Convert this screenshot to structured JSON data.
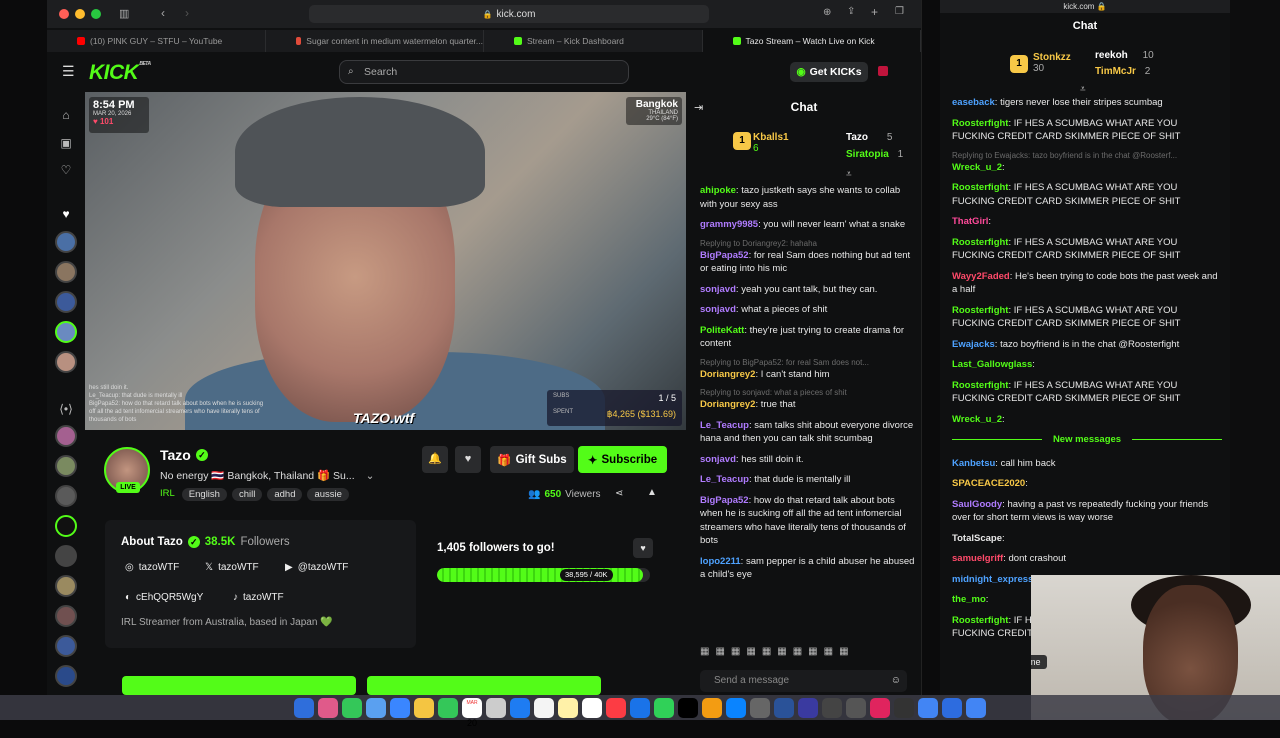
{
  "browser": {
    "url": "kick.com",
    "tabs": [
      {
        "label": "(10) PINK GUY – STFU – YouTube",
        "color": "#ff0000"
      },
      {
        "label": "Sugar content in medium watermelon quarter...",
        "color": "#e04b3a"
      },
      {
        "label": "Stream – Kick Dashboard",
        "color": "#53fc18"
      },
      {
        "label": "Tazo Stream – Watch Live on Kick",
        "color": "#53fc18"
      }
    ]
  },
  "header": {
    "logo": "KICK",
    "logo_sup": "BETA",
    "search_placeholder": "Search",
    "get_kicks": "Get KICKs"
  },
  "video": {
    "time": "8:54 PM",
    "date": "MAR 20, 2026",
    "heart_count": "101",
    "city": "Bangkok",
    "country": "THAILAND",
    "temp": "29°C (84°F)",
    "subs_label": "SUBS",
    "subs_frac": "1 / 5",
    "spent_label": "SPENT",
    "spent_amount": "฿4,265 ($131.69)",
    "watermark": "TAZO.wtf",
    "overlay_chat": [
      "hes still doin it.",
      "Le_Teacup: that dude is mentally ill",
      "BigPapa52: how do that retard talk about bots when he is sucking off all the ad tent infomercial streamers who have literally tens of thousands of bots"
    ]
  },
  "streamer": {
    "name": "Tazo",
    "live": "LIVE",
    "title": "No energy 🇹🇭 Bangkok, Thailand 🎁 Su...",
    "category": "IRL",
    "tags": [
      "English",
      "chill",
      "adhd",
      "aussie"
    ],
    "gift_subs": "Gift Subs",
    "subscribe": "Subscribe",
    "viewers_count": "650",
    "viewers_label": "Viewers"
  },
  "about": {
    "title": "About Tazo",
    "followers": "38.5K",
    "followers_label": "Followers",
    "instagram": "tazoWTF",
    "x": "tazoWTF",
    "youtube": "@tazoWTF",
    "discord": "cEhQQR5WgY",
    "tiktok": "tazoWTF",
    "bio": "IRL Streamer from Australia, based in Japan 💚"
  },
  "goal": {
    "title": "1,405 followers to go!",
    "count": "38,595 / 40K",
    "progress": 0.965
  },
  "chat1": {
    "title": "Chat",
    "leaders": [
      {
        "name": "Kballs1",
        "count": "6"
      },
      {
        "name": "Tazo",
        "count": "5"
      },
      {
        "name": "Siratopia",
        "count": "1"
      }
    ],
    "messages": [
      {
        "user": "ahipoke",
        "color": "#53fc18",
        "text": "tazo justketh says she wants to collab with your sexy ass"
      },
      {
        "user": "grammy9985",
        "color": "#b07cff",
        "text": "you will never learn' what a snake"
      },
      {
        "reply": "Replying to Doriangrey2: hahaha",
        "user": "BigPapa52",
        "color": "#b07cff",
        "text": "for real Sam does nothing but ad tent or eating into his mic"
      },
      {
        "user": "sonjavd",
        "color": "#b07cff",
        "text": "yeah you cant talk, but they can."
      },
      {
        "user": "sonjavd",
        "color": "#b07cff",
        "text": "what a pieces of shit"
      },
      {
        "user": "PoliteKatt",
        "color": "#53fc18",
        "text": "they're just trying to create drama for content"
      },
      {
        "reply": "Replying to BigPapa52: for real Sam does not...",
        "user": "Doriangrey2",
        "color": "#f7c847",
        "text": "I can't stand him"
      },
      {
        "reply": "Replying to sonjavd: what a pieces of shit",
        "user": "Doriangrey2",
        "color": "#f7c847",
        "text": "true that"
      },
      {
        "user": "Le_Teacup",
        "color": "#b07cff",
        "text": "sam talks shit about everyone divorce hana and then you can talk shit scumbag"
      },
      {
        "user": "sonjavd",
        "color": "#b07cff",
        "text": "hes still doin it."
      },
      {
        "user": "Le_Teacup",
        "color": "#b07cff",
        "text": "that dude is mentally ill"
      },
      {
        "user": "BigPapa52",
        "color": "#b07cff",
        "text": "how do that retard talk about bots when he is sucking off all the ad tent infomercial streamers who have literally tens of thousands of bots"
      },
      {
        "user": "lopo2211",
        "color": "#4ea2ff",
        "text": "sam pepper is a child abuser he abused a child's eye"
      }
    ],
    "input_placeholder": "Send a message"
  },
  "chat2": {
    "url": "kick.com",
    "title": "Chat",
    "leaders": [
      {
        "name": "Stonkzz",
        "count": "30"
      },
      {
        "name": "reekoh",
        "count": "10"
      },
      {
        "name": "TimMcJr",
        "count": "2"
      }
    ],
    "messages": [
      {
        "user": "easeback",
        "color": "#4ea2ff",
        "text": "tigers never lose their stripes scumbag"
      },
      {
        "user": "Roosterfight",
        "color": "#53fc18",
        "text": "IF HES A SCUMBAG WHAT ARE YOU FUCKING CREDIT CARD SKIMMER PIECE OF SHIT"
      },
      {
        "reply": "Replying to Ewajacks: tazo boyfriend is in the chat @Roosterf...",
        "user": "Wreck_u_2",
        "color": "#53fc18",
        "text": ""
      },
      {
        "user": "Roosterfight",
        "color": "#53fc18",
        "text": "IF HES A SCUMBAG WHAT ARE YOU FUCKING CREDIT CARD SKIMMER PIECE OF SHIT"
      },
      {
        "user": "ThatGirl",
        "color": "#ff4a9a",
        "text": ""
      },
      {
        "user": "Roosterfight",
        "color": "#53fc18",
        "text": "IF HES A SCUMBAG WHAT ARE YOU FUCKING CREDIT CARD SKIMMER PIECE OF SHIT"
      },
      {
        "user": "Wayy2Faded",
        "color": "#ff4a6a",
        "text": "He's been trying to code bots the past week and a half"
      },
      {
        "user": "Roosterfight",
        "color": "#53fc18",
        "text": "IF HES A SCUMBAG WHAT ARE YOU FUCKING CREDIT CARD SKIMMER PIECE OF SHIT"
      },
      {
        "user": "Ewajacks",
        "color": "#4ea2ff",
        "text": "tazo boyfriend is in the chat @Roosterfight"
      },
      {
        "user": "Last_Gallowglass",
        "color": "#53fc18",
        "text": ""
      },
      {
        "user": "Roosterfight",
        "color": "#53fc18",
        "text": "IF HES A SCUMBAG WHAT ARE YOU FUCKING CREDIT CARD SKIMMER PIECE OF SHIT"
      },
      {
        "user": "Wreck_u_2",
        "color": "#53fc18",
        "text": ""
      }
    ],
    "new_messages_label": "New messages",
    "new_messages": [
      {
        "user": "Kanbetsu",
        "color": "#4ea2ff",
        "text": "call him back"
      },
      {
        "user": "SPACEACE2020",
        "color": "#f7c847",
        "text": ""
      },
      {
        "user": "SaulGoody",
        "color": "#b07cff",
        "text": "having a past vs repeatedly fucking your friends over for short term views is way worse"
      },
      {
        "user": "TotalScape",
        "color": "#e8e8e8",
        "text": ""
      },
      {
        "user": "samuelgriff",
        "color": "#ff4a6a",
        "text": "dont crashout"
      },
      {
        "user": "midnight_express",
        "color": "#4ea2ff",
        "text": ""
      },
      {
        "user": "the_mo",
        "color": "#53fc18",
        "text": ""
      },
      {
        "user": "Roosterfight",
        "color": "#53fc18",
        "text": "IF HES A SCUMBAG WHAT ARE YOU FUCKING CREDIT"
      }
    ],
    "tooltip": "Google Chrome"
  },
  "dock": {
    "calendar_day": "20",
    "calendar_month": "MAR"
  },
  "colors": {
    "accent": "#53fc18",
    "bg": "#0f1011"
  }
}
